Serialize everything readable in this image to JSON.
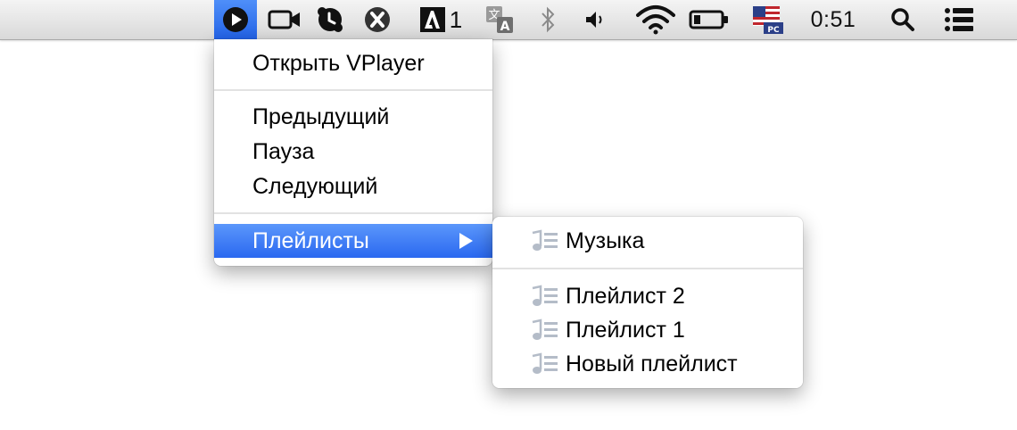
{
  "menubar": {
    "app_badge_count": "1",
    "clock": "0:51",
    "icons": [
      "vplayer-play-icon",
      "facetime-camera-icon",
      "skype-icon",
      "x-app-icon",
      "adobe-icon",
      "translate-icon",
      "bluetooth-icon",
      "volume-icon",
      "wifi-icon",
      "battery-icon",
      "us-flag-input-icon",
      "spotlight-search-icon",
      "notification-list-icon"
    ],
    "active_color": "#2a68f0"
  },
  "main_menu": {
    "open_label": "Открыть VPlayer",
    "previous_label": "Предыдущий",
    "pause_label": "Пауза",
    "next_label": "Следующий",
    "playlists_label": "Плейлисты"
  },
  "playlists_submenu": {
    "items": [
      {
        "label": "Музыка"
      },
      {
        "label": "Плейлист 2"
      },
      {
        "label": "Плейлист 1"
      },
      {
        "label": "Новый плейлист"
      }
    ]
  },
  "colors": {
    "highlight": "#2a68f0",
    "menubar_bg": "#e2e2e2"
  }
}
